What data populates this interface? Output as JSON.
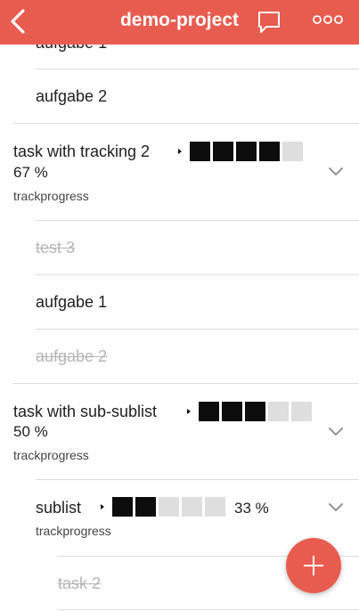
{
  "header": {
    "title": "demo-project",
    "color": "#e85c4f",
    "back_icon": "chevron-left-icon",
    "chat_icon": "chat-bubble-icon",
    "more_icon": "more-dots-icon"
  },
  "items": [
    {
      "label": "aufgabe 1",
      "done": false
    },
    {
      "label": "aufgabe 2",
      "done": false
    },
    {
      "title": "task with tracking 2",
      "percent": "67 %",
      "sublabel": "trackprogress",
      "progress_filled": 4,
      "progress_total": 5
    },
    {
      "label": "test 3",
      "done": true
    },
    {
      "label": "aufgabe 1",
      "done": false
    },
    {
      "label": "aufgabe 2",
      "done": true
    },
    {
      "title": "task with sub-sublist",
      "percent": "50 %",
      "sublabel": "trackprogress",
      "progress_filled": 3,
      "progress_total": 5
    },
    {
      "title": "sublist",
      "percent": "33 %",
      "sublabel": "trackprogress",
      "progress_filled": 2,
      "progress_total": 5
    },
    {
      "label": "task 2",
      "done": true
    }
  ],
  "fab": {
    "icon": "plus-icon"
  }
}
